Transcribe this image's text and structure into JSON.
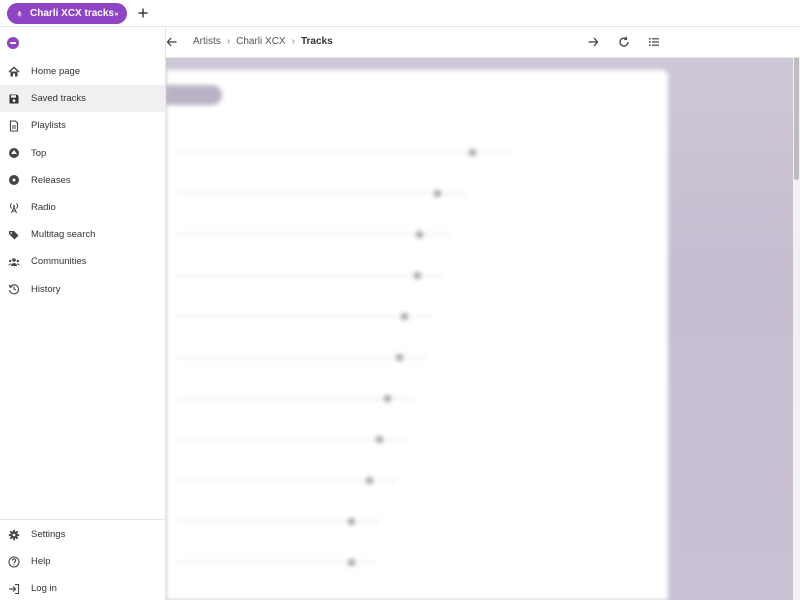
{
  "tab": {
    "title": "Charli XCX tracks",
    "close_label": "×"
  },
  "breadcrumbs": [
    {
      "label": "Artists"
    },
    {
      "label": "Charli XCX"
    },
    {
      "label": "Tracks"
    }
  ],
  "sidebar": {
    "items": [
      {
        "label": "Home page",
        "icon": "home-icon"
      },
      {
        "label": "Saved tracks",
        "icon": "floppy-icon"
      },
      {
        "label": "Playlists",
        "icon": "playlist-icon"
      },
      {
        "label": "Top",
        "icon": "top-icon"
      },
      {
        "label": "Releases",
        "icon": "disc-icon"
      },
      {
        "label": "Radio",
        "icon": "radio-icon"
      },
      {
        "label": "Multitag search",
        "icon": "tags-icon"
      },
      {
        "label": "Communities",
        "icon": "users-icon"
      },
      {
        "label": "History",
        "icon": "history-icon"
      }
    ],
    "bottom_items": [
      {
        "label": "Settings",
        "icon": "gear-icon"
      },
      {
        "label": "Help",
        "icon": "help-icon"
      },
      {
        "label": "Log in",
        "icon": "login-icon"
      }
    ]
  },
  "colors": {
    "accent": "#8e44c4"
  }
}
